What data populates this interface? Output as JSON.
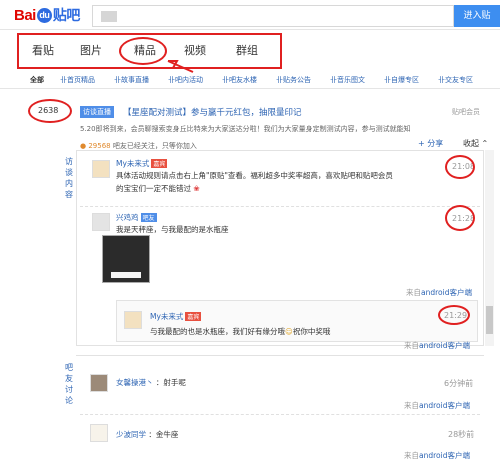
{
  "header": {
    "logo_text_bai": "Bai",
    "logo_text_du": "du",
    "logo_text_tieba": "贴吧",
    "search_button": "进入贴"
  },
  "tabs": [
    "看贴",
    "图片",
    "精品",
    "视频",
    "群组"
  ],
  "categories": [
    "全部",
    "卝首页精品",
    "卝故事直播",
    "卝吧内活动",
    "卝吧友水楼",
    "卝贴务公告",
    "卝音乐图文",
    "卝自爆专区",
    "卝交友专区"
  ],
  "thread": {
    "reply_count": "2638",
    "badge": "访谈直播",
    "title": "【星座配对测试】参与赢千元红包，抽限量印记",
    "owner": "贴吧会员",
    "description": "5.20即将到来，会员聊搜索变身丘比特来为大家送达分啦！我们为大家量身定制测试内容，参与测试就能知",
    "meta_num": "29568",
    "meta_text": "吧友已经关注，只等你加入",
    "share": "分享",
    "collapse": "收起"
  },
  "side_labels": {
    "interview": [
      "访",
      "谈",
      "内",
      "容"
    ],
    "discuss": [
      "吧",
      "友",
      "讨",
      "论"
    ]
  },
  "posts": [
    {
      "user": "My未来式",
      "tag": "嘉宾",
      "line1": "具体活动规则请点击右上角\"原贴\"查看。福利超多中奖率超高，喜欢贴吧和贴吧会员",
      "line2": "的宝宝们一定不能错过",
      "time": "21:08"
    },
    {
      "user": "兴鸡鸡",
      "tag": "吧友",
      "line1": "我是天秤座，与我最配的是水瓶座",
      "time": "21:28",
      "source_prefix": "来自",
      "source_link": "android客户端"
    }
  ],
  "reply": {
    "user": "My未来式",
    "tag": "嘉宾",
    "text": "与我最配的也是水瓶座，我们好有缘分哦",
    "text_suffix": "祝你中奖哦",
    "time": "21:29",
    "source_prefix": "来自",
    "source_link": "android客户端"
  },
  "discussion": [
    {
      "user": "女馨操港丶",
      "text": "射手呢",
      "time": "6分钟前",
      "source_prefix": "来自",
      "source_link": "android客户端"
    },
    {
      "user": "少波同学",
      "text": "金牛座",
      "time": "28秒前",
      "source_prefix": "来自",
      "source_link": "android客户端"
    }
  ],
  "colors": {
    "accent_blue": "#2d64b3",
    "annotation_red": "#e02020",
    "search_button": "#3d8ef0"
  }
}
